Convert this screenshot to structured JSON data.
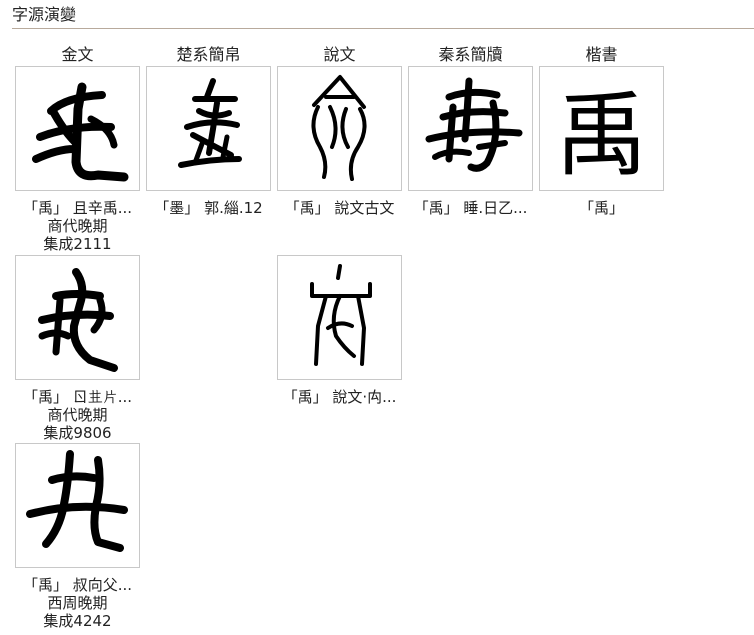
{
  "title": "字源演變",
  "columns": [
    "金文",
    "楚系簡帛",
    "說文",
    "秦系簡牘",
    "楷書"
  ],
  "cells": [
    {
      "icon": "bronze-glyph-1",
      "caption": [
        "「禹」 且辛禹...",
        "商代晚期",
        "集成2111"
      ]
    },
    {
      "icon": "chu-bamboo-glyph",
      "caption": [
        "「墨」 郭.緇.12"
      ]
    },
    {
      "icon": "shuowen-guwen-glyph",
      "caption": [
        "「禹」 說文古文"
      ]
    },
    {
      "icon": "qin-bamboo-glyph",
      "caption": [
        "「禹」 睡.日乙..."
      ]
    },
    {
      "icon": "kaishu-glyph",
      "char": "禹",
      "caption": [
        "「禹」"
      ]
    },
    {
      "icon": "bronze-glyph-2",
      "caption": [
        "「禹」 ㄖ𠀎片...",
        "商代晚期",
        "集成9806"
      ]
    },
    {
      "icon": "shuowen-seal-glyph",
      "caption": [
        "「禹」 說文‧禸..."
      ]
    },
    {
      "icon": "bronze-glyph-3",
      "caption": [
        "「禹」 叔向父...",
        "西周晚期",
        "集成4242"
      ]
    }
  ]
}
